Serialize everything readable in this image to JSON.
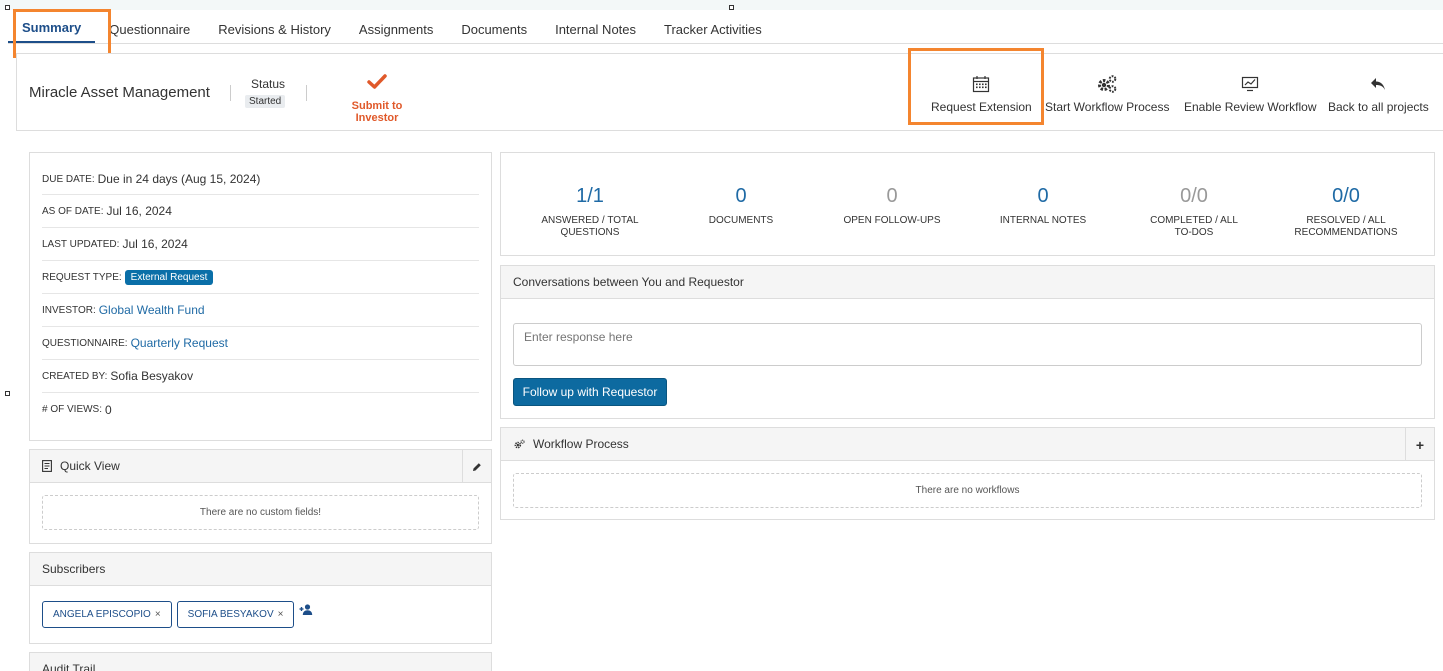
{
  "tabs": [
    {
      "label": "Summary",
      "active": true
    },
    {
      "label": "Questionnaire"
    },
    {
      "label": "Revisions & History"
    },
    {
      "label": "Assignments"
    },
    {
      "label": "Documents"
    },
    {
      "label": "Internal Notes"
    },
    {
      "label": "Tracker Activities"
    }
  ],
  "header": {
    "company": "Miracle Asset Management",
    "status_label": "Status",
    "status_value": "Started",
    "submit_label": "Submit to Investor",
    "actions": {
      "request_extension": "Request Extension",
      "start_workflow": "Start Workflow Process",
      "enable_review": "Enable Review Workflow",
      "back": "Back to all projects"
    }
  },
  "info": {
    "due_date_key": "Due Date:",
    "due_date": "Due in 24 days (Aug 15, 2024)",
    "as_of_key": "As of Date:",
    "as_of": "Jul 16, 2024",
    "last_updated_key": "Last Updated:",
    "last_updated": "Jul 16, 2024",
    "request_type_key": "Request Type:",
    "request_type": "External Request",
    "investor_key": "Investor:",
    "investor": "Global Wealth Fund",
    "questionnaire_key": "Questionnaire:",
    "questionnaire": "Quarterly Request",
    "created_by_key": "Created By:",
    "created_by": "Sofia Besyakov",
    "views_key": "# of Views:",
    "views": "0"
  },
  "quick_view": {
    "title": "Quick View",
    "empty": "There are no custom fields!"
  },
  "subscribers": {
    "title": "Subscribers",
    "items": [
      "ANGELA EPISCOPIO",
      "SOFIA BESYAKOV"
    ],
    "remove_glyph": "×"
  },
  "audit": {
    "title": "Audit Trail"
  },
  "stats": [
    {
      "value": "1/1",
      "label": "Answered / Total Questions"
    },
    {
      "value": "0",
      "label": "Documents"
    },
    {
      "value": "0",
      "label": "Open Follow-Ups"
    },
    {
      "value": "0",
      "label": "Internal Notes"
    },
    {
      "value": "0/0",
      "label": "Completed / All To-Dos"
    },
    {
      "value": "0/0",
      "label": "Resolved / All Recommendations"
    }
  ],
  "conversation": {
    "title": "Conversations between You and Requestor",
    "placeholder": "Enter response here",
    "button": "Follow up with Requestor"
  },
  "workflow": {
    "title": "Workflow Process",
    "add_glyph": "+",
    "empty": "There are no workflows"
  },
  "colors": {
    "accent": "#1d4e89",
    "link": "#1f6aa5",
    "primary_button": "#0d6aa0",
    "highlight": "#f4852f",
    "submit": "#e0592a"
  }
}
